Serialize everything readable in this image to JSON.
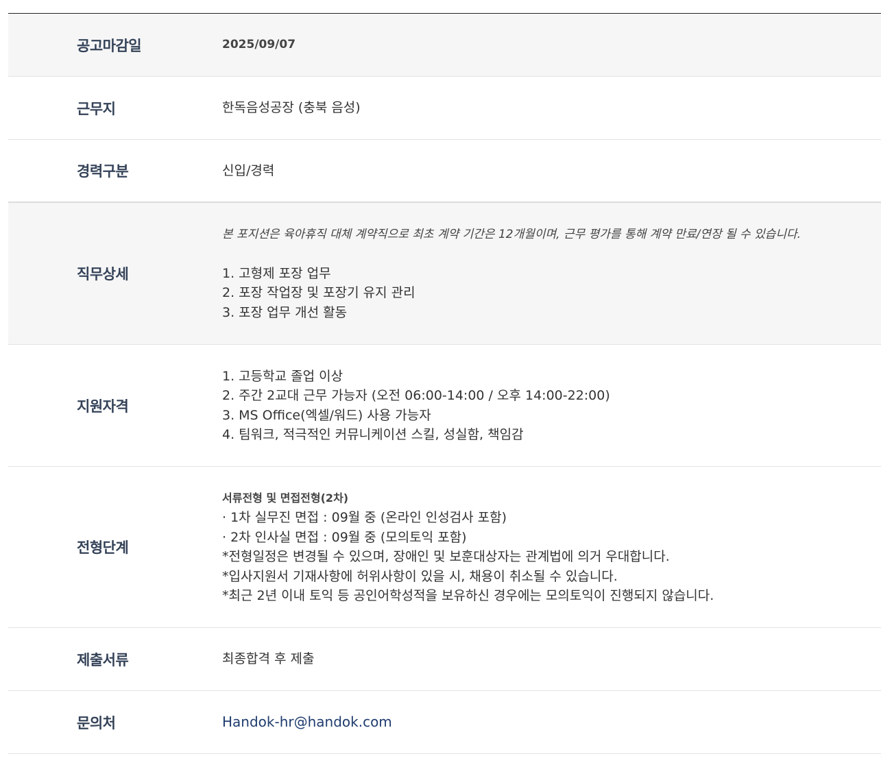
{
  "rows": {
    "deadline": {
      "label": "공고마감일",
      "value": "2025/09/07"
    },
    "location": {
      "label": "근무지",
      "value": "한독음성공장 (충북 음성)"
    },
    "career": {
      "label": "경력구분",
      "value": "신입/경력"
    },
    "duty": {
      "label": "직무상세",
      "note": "본 포지션은 육아휴직 대체 계약직으로 최초 계약 기간은 12개월이며, 근무 평가를 통해 계약 만료/연장 될 수 있습니다.",
      "lines": [
        "1. 고형제 포장 업무",
        "2. 포장 작업장 및 포장기 유지 관리",
        "3. 포장 업무 개선 활동"
      ]
    },
    "qualification": {
      "label": "지원자격",
      "lines": [
        "1. 고등학교 졸업 이상",
        "2. 주간 2교대 근무 가능자 (오전 06:00-14:00 / 오후 14:00-22:00)",
        "3. MS Office(엑셀/워드) 사용 가능자",
        "4. 팀워크, 적극적인 커뮤니케이션 스킬, 성실함, 책임감"
      ]
    },
    "process": {
      "label": "전형단계",
      "heading": "서류전형 및 면접전형(2차)",
      "lines": [
        " ·  1차 실무진 면접 : 09월 중 (온라인 인성검사 포함)",
        " ·  2차 인사실 면접 : 09월 중 (모의토익 포함)",
        "*전형일정은 변경될 수 있으며, 장애인 및 보훈대상자는 관계법에 의거 우대합니다.",
        "*입사지원서 기재사항에 허위사항이 있을 시, 채용이 취소될 수 있습니다.",
        "*최근 2년 이내 토익 등 공인어학성적을 보유하신 경우에는 모의토익이 진행되지 않습니다."
      ]
    },
    "documents": {
      "label": "제출서류",
      "value": "최종합격 후 제출"
    },
    "contact": {
      "label": "문의처",
      "value": "Handok-hr@handok.com"
    }
  }
}
